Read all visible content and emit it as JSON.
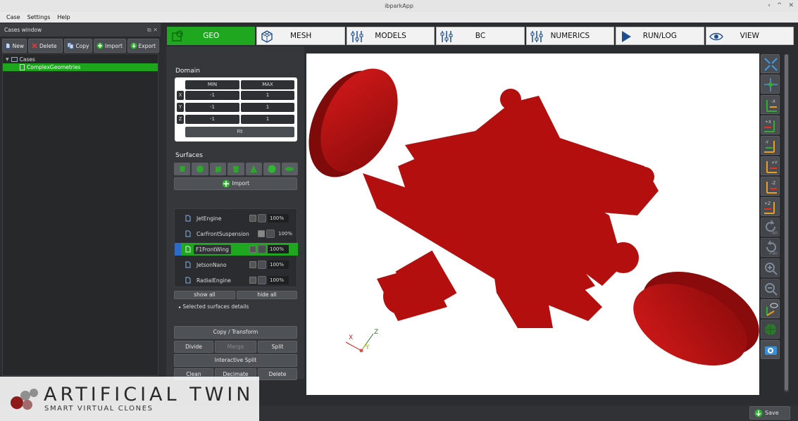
{
  "window": {
    "title": "ibparkApp",
    "controls": [
      "‹",
      "^",
      "✕"
    ]
  },
  "menu": [
    "Case",
    "Settings",
    "Help"
  ],
  "cases_window": {
    "title": "Cases window",
    "toolbar": [
      "New",
      "Delete",
      "Copy",
      "Import",
      "Export"
    ],
    "tree": {
      "root": "Cases",
      "items": [
        "ComplexGeometries"
      ]
    }
  },
  "tabs": [
    "GEO",
    "MESH",
    "MODELS",
    "BC",
    "NUMERICS",
    "RUN/LOG",
    "VIEW"
  ],
  "domain": {
    "title": "Domain",
    "min_header": "MIN",
    "max_header": "MAX",
    "axes": [
      "X",
      "Y",
      "Z"
    ],
    "min": [
      "-1",
      "-1",
      "-1"
    ],
    "max": [
      "1",
      "1",
      "1"
    ],
    "fit": "Fit"
  },
  "surfaces": {
    "title": "Surfaces",
    "import": "Import",
    "list": [
      {
        "name": "JetEngine",
        "percent": "100%"
      },
      {
        "name": "CarFrontSuspension",
        "percent": "100%"
      },
      {
        "name": "F1FrontWing",
        "percent": "100%"
      },
      {
        "name": "JetsonNano",
        "percent": "100%"
      },
      {
        "name": "RadialEngine",
        "percent": "100%"
      }
    ],
    "show_all": "show all",
    "hide_all": "hide all",
    "details": "Selected surfaces details"
  },
  "actions": {
    "copy_transform": "Copy / Transform",
    "divide": "Divide",
    "merge": "Merge",
    "split": "Split",
    "interactive_split": "Interactive Split",
    "clean": "Clean",
    "decimate": "Decimate",
    "delete": "Delete"
  },
  "viewport": {
    "model_color": "#b30f0f",
    "axis_labels": [
      "X",
      "Y",
      "Z"
    ]
  },
  "right_tools": [
    "fit-all",
    "center",
    "view-minus-x",
    "view-plus-x",
    "view-minus-y",
    "view-plus-y",
    "view-minus-z",
    "view-plus-z",
    "rotate-minus-90",
    "rotate-plus-90",
    "zoom-in",
    "zoom-out",
    "pick",
    "globe",
    "screenshot"
  ],
  "rotate_labels": {
    "minus": "-90",
    "plus": "+90"
  },
  "status": {
    "save": "Save"
  },
  "branding": {
    "word": "ARTIFICIAL TWIN",
    "tagline": "SMART VIRTUAL CLONES"
  },
  "colors": {
    "accent": "#1fa81f",
    "panel": "#35373b",
    "model": "#b30f0f"
  }
}
